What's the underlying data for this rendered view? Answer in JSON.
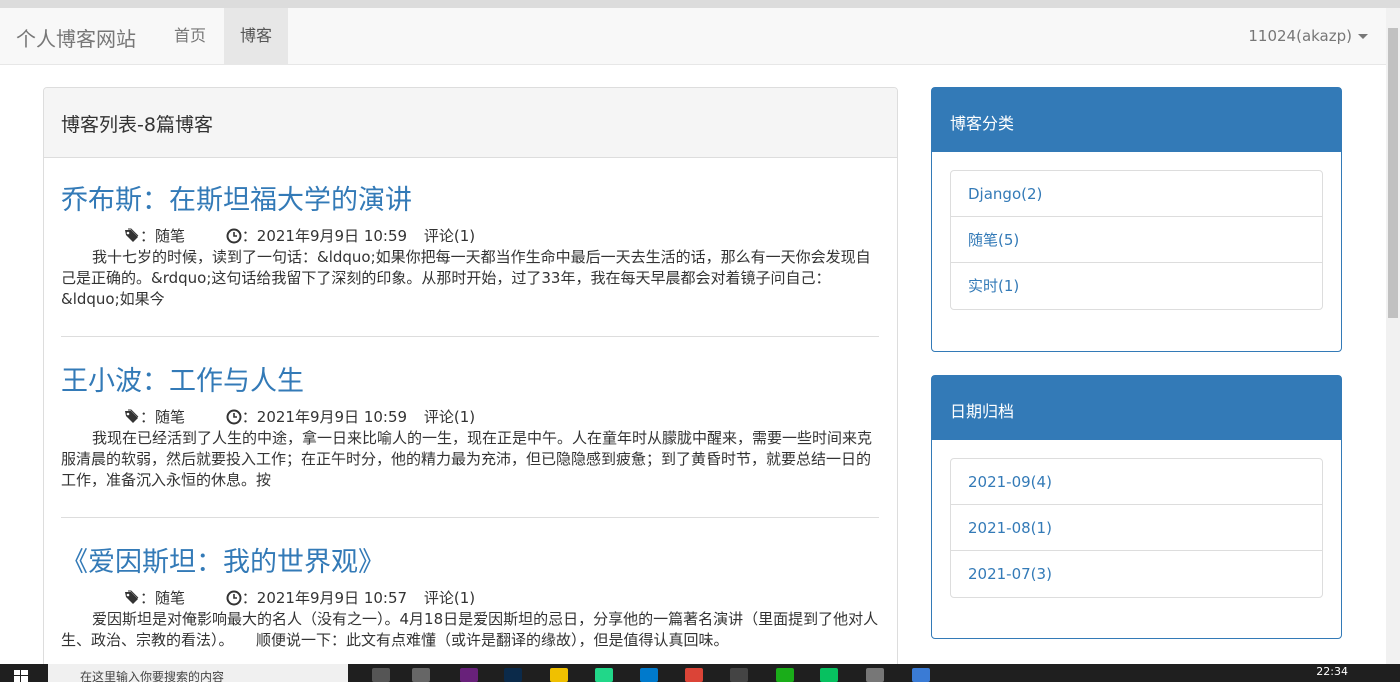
{
  "navbar": {
    "brand": "个人博客网站",
    "home": "首页",
    "blog": "博客",
    "user": "11024(akazp)"
  },
  "main": {
    "heading": "博客列表-8篇博客",
    "posts": [
      {
        "title": "乔布斯：在斯坦福大学的演讲",
        "category": "：随笔",
        "date": "：2021年9月9日 10:59",
        "comments": "评论(1)",
        "excerpt": "我十七岁的时候，读到了一句话：&ldquo;如果你把每一天都当作生命中最后一天去生活的话，那么有一天你会发现自己是正确的。&rdquo;这句话给我留下了深刻的印象。从那时开始，过了33年，我在每天早晨都会对着镜子问自己：&ldquo;如果今"
      },
      {
        "title": "王小波：工作与人生",
        "category": "：随笔",
        "date": "：2021年9月9日 10:59",
        "comments": "评论(1)",
        "excerpt": "我现在已经活到了人生的中途，拿一日来比喻人的一生，现在正是中午。人在童年时从朦胧中醒来，需要一些时间来克服清晨的软弱，然后就要投入工作；在正午时分，他的精力最为充沛，但已隐隐感到疲惫；到了黄昏时节，就要总结一日的工作，准备沉入永恒的休息。按"
      },
      {
        "title": "《爱因斯坦：我的世界观》",
        "category": "：随笔",
        "date": "：2021年9月9日 10:57",
        "comments": "评论(1)",
        "excerpt": "爱因斯坦是对俺影响最大的名人（没有之一）。4月18日是爱因斯坦的忌日，分享他的一篇著名演讲（里面提到了他对人生、政治、宗教的看法）。　　顺便说一下：此文有点难懂（或许是翻译的缘故），但是值得认真回味。"
      }
    ]
  },
  "sidebar": {
    "categories": {
      "heading": "博客分类",
      "items": [
        "Django(2)",
        "随笔(5)",
        "实时(1)"
      ]
    },
    "archive": {
      "heading": "日期归档",
      "items": [
        "2021-09(4)",
        "2021-08(1)",
        "2021-07(3)"
      ]
    }
  },
  "taskbar": {
    "search_placeholder": "在这里输入你要搜索的内容",
    "time": "22:34"
  },
  "colors": {
    "link": "#337ab7",
    "panel_header": "#337ab7"
  }
}
